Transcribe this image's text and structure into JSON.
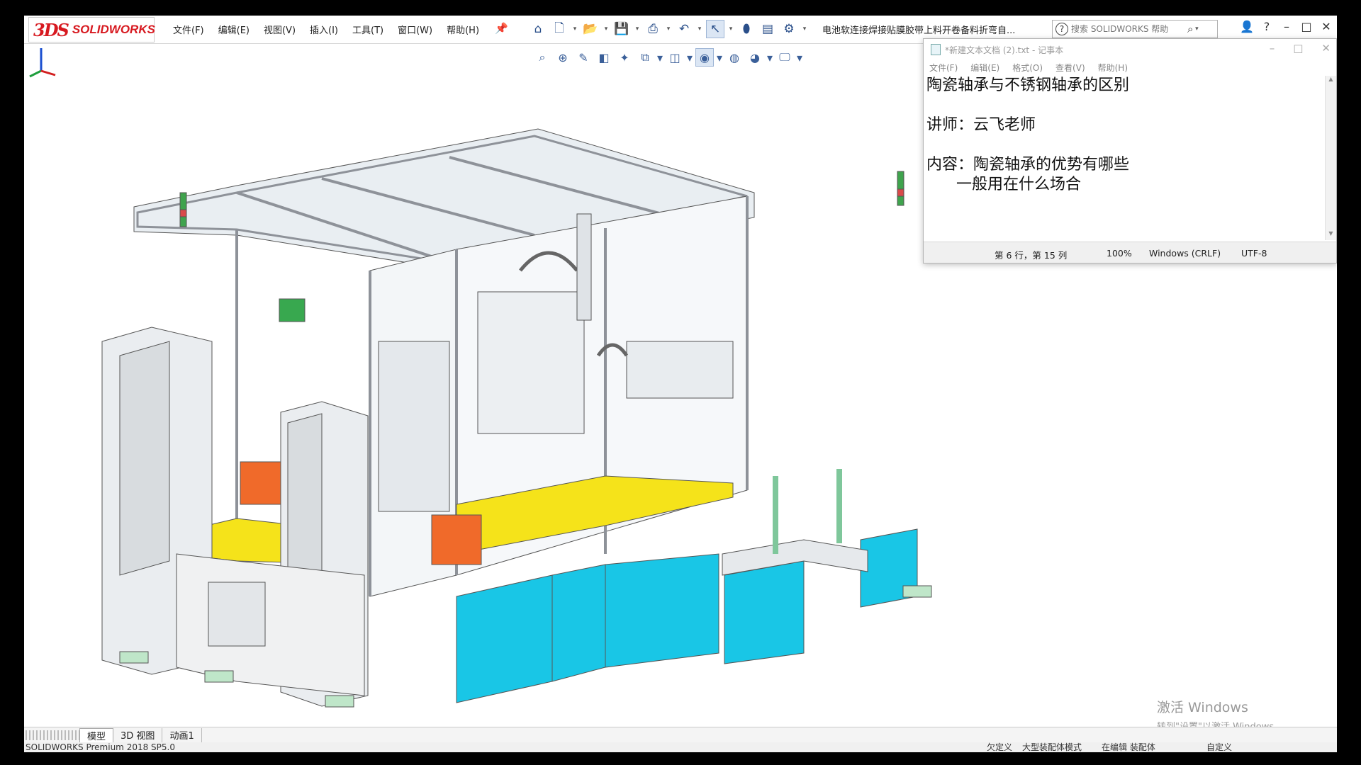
{
  "solidworks": {
    "logo_ds": "3DS",
    "logo_name": "SOLIDWORKS",
    "menu": [
      "文件(F)",
      "编辑(E)",
      "视图(V)",
      "插入(I)",
      "工具(T)",
      "窗口(W)",
      "帮助(H)"
    ],
    "document_title": "电池软连接焊接贴膜胶带上料开卷备料折弯自...",
    "search_placeholder": "搜索 SOLIDWORKS 帮助",
    "tabs": [
      "模型",
      "3D 视图",
      "动画1"
    ],
    "status_left": "SOLIDWORKS Premium 2018 SP5.0",
    "status_right": [
      "欠定义",
      "大型装配体模式",
      "在编辑 装配体",
      "自定义"
    ],
    "toolbar_icons": [
      "home-icon",
      "new-document-icon",
      "open-folder-icon",
      "save-icon",
      "print-icon",
      "undo-icon",
      "select-cursor-icon",
      "traffic-light-icon",
      "file-properties-icon",
      "options-gear-icon"
    ],
    "view_toolbar_icons": [
      "zoom-to-fit-icon",
      "zoom-area-icon",
      "previous-view-icon",
      "section-view-icon",
      "dynamic-annotation-icon",
      "view-orientation-icon",
      "display-style-icon",
      "hide-show-icon",
      "edit-appearance-icon",
      "apply-scene-icon",
      "view-settings-icon"
    ],
    "accent_color": "#d71920"
  },
  "notepad": {
    "title": "*新建文本文档 (2).txt - 记事本",
    "menu": [
      "文件(F)",
      "编辑(E)",
      "格式(O)",
      "查看(V)",
      "帮助(H)"
    ],
    "lines": [
      "陶瓷轴承与不锈钢轴承的区别",
      "",
      "讲师：云飞老师",
      "",
      "内容：陶瓷轴承的优势有哪些",
      "      一般用在什么场合"
    ],
    "status": {
      "position": "第 6 行，第 15 列",
      "zoom": "100%",
      "line_ending": "Windows (CRLF)",
      "encoding": "UTF-8"
    }
  },
  "watermark": {
    "line1": "激活 Windows",
    "line2": "转到\"设置\"以激活 Windows。"
  },
  "colors": {
    "cabinet_cyan": "#19c6e6",
    "plate_yellow": "#f5e31a",
    "module_orange": "#f06a2a",
    "frame_gray": "#8e9299"
  }
}
